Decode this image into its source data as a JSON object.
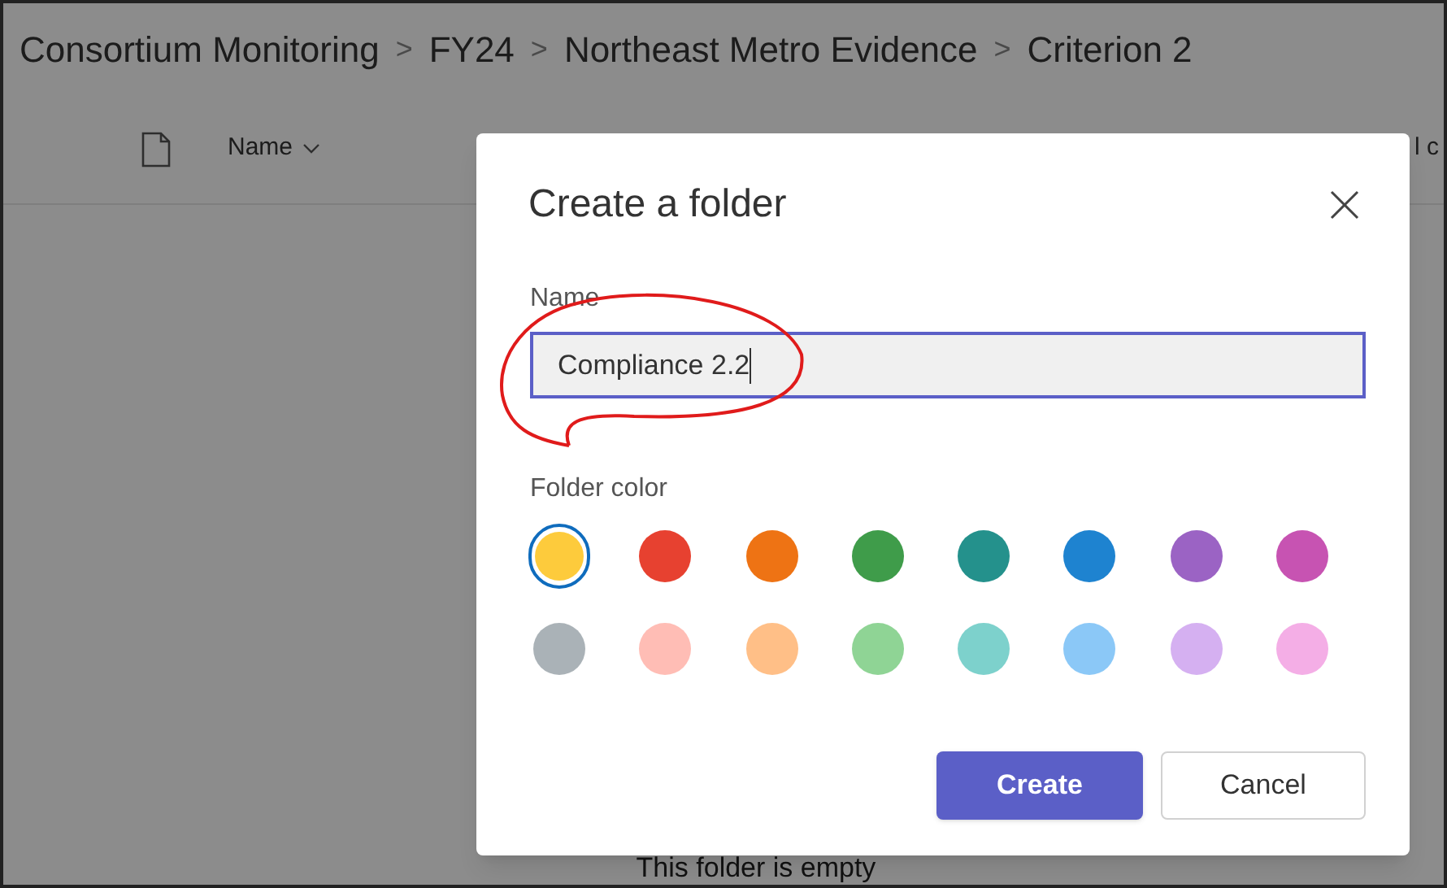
{
  "breadcrumb": [
    {
      "label": "Consortium Monitoring"
    },
    {
      "label": "FY24"
    },
    {
      "label": "Northeast Metro Evidence"
    },
    {
      "label": "Criterion 2"
    }
  ],
  "separator": ">",
  "list_header": {
    "name_column": "Name",
    "column_3": "l c"
  },
  "empty_message": "This folder is empty",
  "dialog": {
    "title": "Create a folder",
    "name_label": "Name",
    "name_value": "Compliance 2.2",
    "color_label": "Folder color",
    "colors": [
      {
        "color": "#fdcb3c",
        "selected": true
      },
      {
        "color": "#e74130",
        "selected": false
      },
      {
        "color": "#ee7314",
        "selected": false
      },
      {
        "color": "#3f9c4a",
        "selected": false
      },
      {
        "color": "#24918c",
        "selected": false
      },
      {
        "color": "#1e83d0",
        "selected": false
      },
      {
        "color": "#9b63c4",
        "selected": false
      },
      {
        "color": "#c753b2",
        "selected": false
      },
      {
        "color": "#aab2b7",
        "selected": false
      },
      {
        "color": "#ffbdb5",
        "selected": false
      },
      {
        "color": "#ffbf87",
        "selected": false
      },
      {
        "color": "#8fd495",
        "selected": false
      },
      {
        "color": "#7dd1cc",
        "selected": false
      },
      {
        "color": "#8bc8f7",
        "selected": false
      },
      {
        "color": "#d5b0f1",
        "selected": false
      },
      {
        "color": "#f4aee6",
        "selected": false
      }
    ],
    "buttons": [
      {
        "label": "Create",
        "kind": "primary"
      },
      {
        "label": "Cancel",
        "kind": "secondary"
      }
    ]
  }
}
